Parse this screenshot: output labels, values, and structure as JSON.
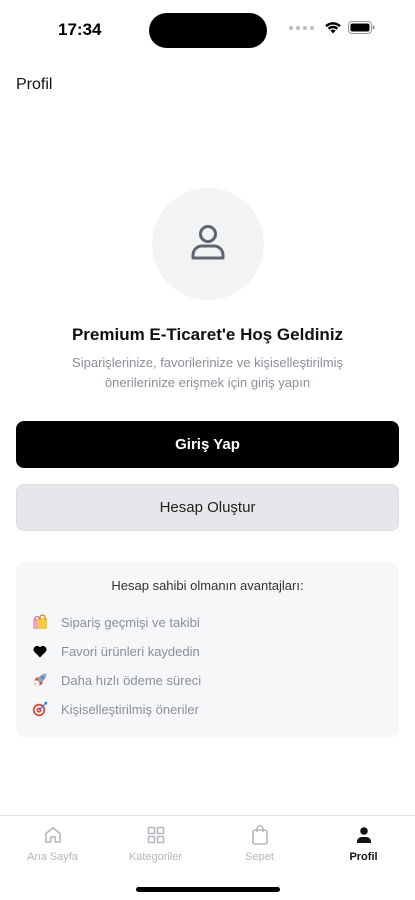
{
  "status_bar": {
    "time": "17:34"
  },
  "header": {
    "title": "Profil"
  },
  "welcome": {
    "title": "Premium E-Ticaret'e Hoş Geldiniz",
    "subtitle": "Siparişlerinize, favorilerinize ve kişiselleştirilmiş önerilerinize erişmek için giriş yapın"
  },
  "buttons": {
    "login": "Giriş Yap",
    "register": "Hesap Oluştur"
  },
  "benefits": {
    "title": "Hesap sahibi olmanın avantajları:",
    "items": [
      {
        "icon": "shopping-bags-icon",
        "label": "Sipariş geçmişi ve takibi"
      },
      {
        "icon": "heart-icon",
        "label": "Favori ürünleri kaydedin"
      },
      {
        "icon": "rocket-icon",
        "label": "Daha hızlı ödeme süreci"
      },
      {
        "icon": "dart-target-icon",
        "label": "Kişiselleştirilmiş öneriler"
      }
    ]
  },
  "tab_bar": {
    "tabs": [
      {
        "icon": "home-icon",
        "label": "Ana Sayfa",
        "active": false
      },
      {
        "icon": "grid-icon",
        "label": "Kategoriler",
        "active": false
      },
      {
        "icon": "bag-icon",
        "label": "Sepet",
        "active": false
      },
      {
        "icon": "person-icon",
        "label": "Profil",
        "active": true
      }
    ]
  },
  "colors": {
    "primary": "#000000",
    "secondary_bg": "#e6e7ea",
    "card_bg": "#f6f7f9",
    "muted_text": "#8a8f98",
    "inactive_tab": "#b4b7bd"
  }
}
